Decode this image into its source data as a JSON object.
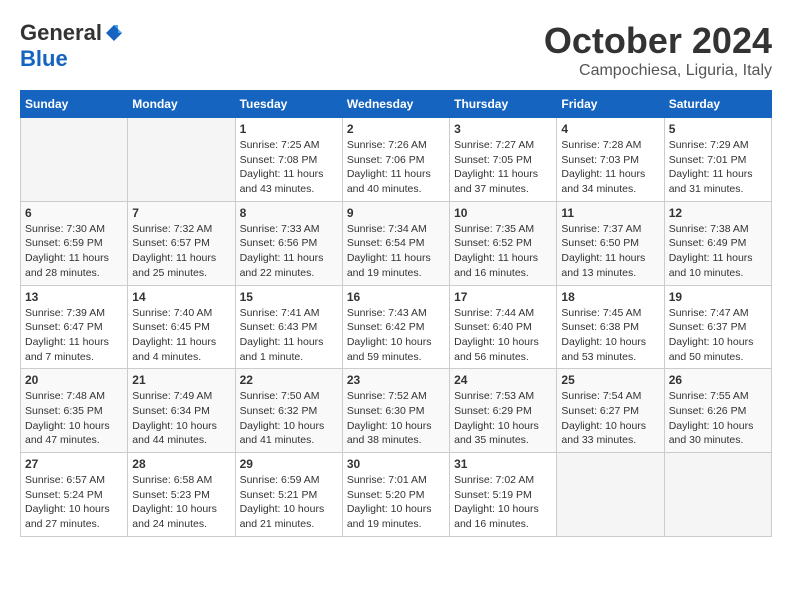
{
  "logo": {
    "general": "General",
    "blue": "Blue"
  },
  "title": "October 2024",
  "location": "Campochiesa, Liguria, Italy",
  "days_of_week": [
    "Sunday",
    "Monday",
    "Tuesday",
    "Wednesday",
    "Thursday",
    "Friday",
    "Saturday"
  ],
  "weeks": [
    [
      {
        "day": "",
        "info": ""
      },
      {
        "day": "",
        "info": ""
      },
      {
        "day": "1",
        "info": "Sunrise: 7:25 AM\nSunset: 7:08 PM\nDaylight: 11 hours and 43 minutes."
      },
      {
        "day": "2",
        "info": "Sunrise: 7:26 AM\nSunset: 7:06 PM\nDaylight: 11 hours and 40 minutes."
      },
      {
        "day": "3",
        "info": "Sunrise: 7:27 AM\nSunset: 7:05 PM\nDaylight: 11 hours and 37 minutes."
      },
      {
        "day": "4",
        "info": "Sunrise: 7:28 AM\nSunset: 7:03 PM\nDaylight: 11 hours and 34 minutes."
      },
      {
        "day": "5",
        "info": "Sunrise: 7:29 AM\nSunset: 7:01 PM\nDaylight: 11 hours and 31 minutes."
      }
    ],
    [
      {
        "day": "6",
        "info": "Sunrise: 7:30 AM\nSunset: 6:59 PM\nDaylight: 11 hours and 28 minutes."
      },
      {
        "day": "7",
        "info": "Sunrise: 7:32 AM\nSunset: 6:57 PM\nDaylight: 11 hours and 25 minutes."
      },
      {
        "day": "8",
        "info": "Sunrise: 7:33 AM\nSunset: 6:56 PM\nDaylight: 11 hours and 22 minutes."
      },
      {
        "day": "9",
        "info": "Sunrise: 7:34 AM\nSunset: 6:54 PM\nDaylight: 11 hours and 19 minutes."
      },
      {
        "day": "10",
        "info": "Sunrise: 7:35 AM\nSunset: 6:52 PM\nDaylight: 11 hours and 16 minutes."
      },
      {
        "day": "11",
        "info": "Sunrise: 7:37 AM\nSunset: 6:50 PM\nDaylight: 11 hours and 13 minutes."
      },
      {
        "day": "12",
        "info": "Sunrise: 7:38 AM\nSunset: 6:49 PM\nDaylight: 11 hours and 10 minutes."
      }
    ],
    [
      {
        "day": "13",
        "info": "Sunrise: 7:39 AM\nSunset: 6:47 PM\nDaylight: 11 hours and 7 minutes."
      },
      {
        "day": "14",
        "info": "Sunrise: 7:40 AM\nSunset: 6:45 PM\nDaylight: 11 hours and 4 minutes."
      },
      {
        "day": "15",
        "info": "Sunrise: 7:41 AM\nSunset: 6:43 PM\nDaylight: 11 hours and 1 minute."
      },
      {
        "day": "16",
        "info": "Sunrise: 7:43 AM\nSunset: 6:42 PM\nDaylight: 10 hours and 59 minutes."
      },
      {
        "day": "17",
        "info": "Sunrise: 7:44 AM\nSunset: 6:40 PM\nDaylight: 10 hours and 56 minutes."
      },
      {
        "day": "18",
        "info": "Sunrise: 7:45 AM\nSunset: 6:38 PM\nDaylight: 10 hours and 53 minutes."
      },
      {
        "day": "19",
        "info": "Sunrise: 7:47 AM\nSunset: 6:37 PM\nDaylight: 10 hours and 50 minutes."
      }
    ],
    [
      {
        "day": "20",
        "info": "Sunrise: 7:48 AM\nSunset: 6:35 PM\nDaylight: 10 hours and 47 minutes."
      },
      {
        "day": "21",
        "info": "Sunrise: 7:49 AM\nSunset: 6:34 PM\nDaylight: 10 hours and 44 minutes."
      },
      {
        "day": "22",
        "info": "Sunrise: 7:50 AM\nSunset: 6:32 PM\nDaylight: 10 hours and 41 minutes."
      },
      {
        "day": "23",
        "info": "Sunrise: 7:52 AM\nSunset: 6:30 PM\nDaylight: 10 hours and 38 minutes."
      },
      {
        "day": "24",
        "info": "Sunrise: 7:53 AM\nSunset: 6:29 PM\nDaylight: 10 hours and 35 minutes."
      },
      {
        "day": "25",
        "info": "Sunrise: 7:54 AM\nSunset: 6:27 PM\nDaylight: 10 hours and 33 minutes."
      },
      {
        "day": "26",
        "info": "Sunrise: 7:55 AM\nSunset: 6:26 PM\nDaylight: 10 hours and 30 minutes."
      }
    ],
    [
      {
        "day": "27",
        "info": "Sunrise: 6:57 AM\nSunset: 5:24 PM\nDaylight: 10 hours and 27 minutes."
      },
      {
        "day": "28",
        "info": "Sunrise: 6:58 AM\nSunset: 5:23 PM\nDaylight: 10 hours and 24 minutes."
      },
      {
        "day": "29",
        "info": "Sunrise: 6:59 AM\nSunset: 5:21 PM\nDaylight: 10 hours and 21 minutes."
      },
      {
        "day": "30",
        "info": "Sunrise: 7:01 AM\nSunset: 5:20 PM\nDaylight: 10 hours and 19 minutes."
      },
      {
        "day": "31",
        "info": "Sunrise: 7:02 AM\nSunset: 5:19 PM\nDaylight: 10 hours and 16 minutes."
      },
      {
        "day": "",
        "info": ""
      },
      {
        "day": "",
        "info": ""
      }
    ]
  ]
}
